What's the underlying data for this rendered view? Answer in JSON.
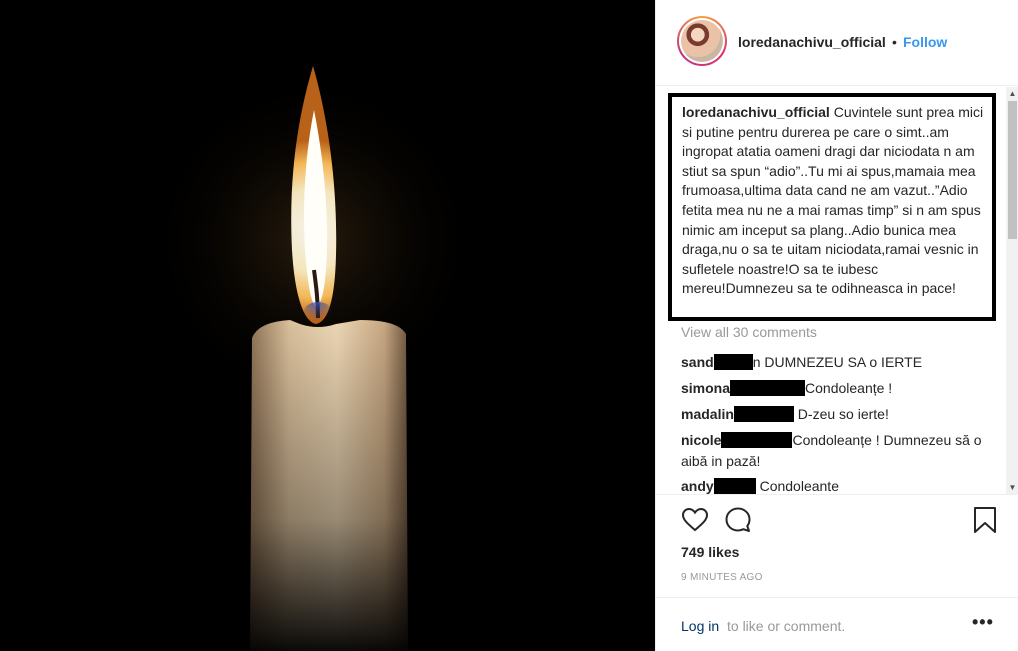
{
  "post": {
    "username": "loredanachivu_official",
    "separator": "•",
    "follow_label": "Follow"
  },
  "caption": {
    "username": "loredanachivu_official",
    "text": "Cuvintele sunt prea mici si putine pentru durerea pe care o simt..am ingropat atatia oameni dragi dar niciodata n am stiut sa spun “adio”..Tu mi ai spus,mamaia mea frumoasa,ultima data cand ne am vazut..”Adio fetita mea nu ne a mai ramas timp” si n am spus nimic am inceput sa plang..Adio bunica mea draga,nu o sa te uitam niciodata,ramai vesnic in sufletele noastre!O sa te iubesc mereu!Dumnezeu sa te odihneasca in pace!"
  },
  "view_all_comments": "View all 30 comments",
  "comments": [
    {
      "user": "sand",
      "text": "n DUMNEZEU SA o IERTE"
    },
    {
      "user": "simona",
      "text": "Condoleanțe !"
    },
    {
      "user": "madalin",
      "text": " D-zeu so ierte!"
    },
    {
      "user": "nicole",
      "text": "Condoleanțe ! Dumnezeu să o aibă in pază!"
    },
    {
      "user": "andy",
      "text": " Condoleante"
    }
  ],
  "actions": {
    "like_icon": "heart-icon",
    "comment_icon": "comment-icon",
    "save_icon": "bookmark-icon"
  },
  "likes": "749 likes",
  "timestamp": "9 MINUTES AGO",
  "login": {
    "link": "Log in",
    "text": "to like or comment."
  },
  "more_label": "•••",
  "scrollbar": {
    "up": "▲",
    "down": "▼"
  }
}
